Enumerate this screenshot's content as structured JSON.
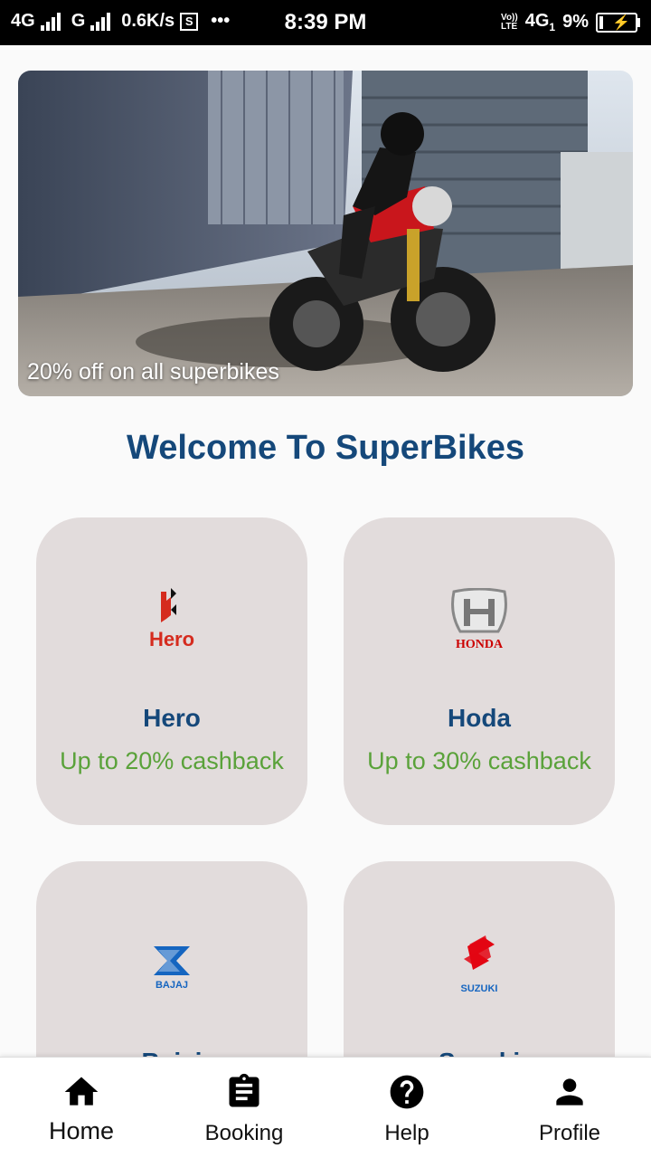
{
  "status_bar": {
    "net1": "4G",
    "net2": "G",
    "speed": "0.6K/s",
    "s_icon": "S",
    "more": "•••",
    "time": "8:39 PM",
    "volte_top": "Vo))",
    "volte_bottom": "LTE",
    "net3": "4G",
    "sim_num": "1",
    "battery": "9%"
  },
  "banner": {
    "caption": "20% off on all superbikes"
  },
  "welcome_title": "Welcome To SuperBikes",
  "brands": [
    {
      "name": "Hero",
      "offer": "Up to 20% cashback",
      "logo_text": "Hero",
      "icon": "hero-logo-icon"
    },
    {
      "name": "Hoda",
      "offer": "Up to 30% cashback",
      "logo_text": "HONDA",
      "icon": "honda-logo-icon"
    },
    {
      "name": "Bajaj",
      "offer": "",
      "logo_text": "BAJAJ",
      "icon": "bajaj-logo-icon"
    },
    {
      "name": "Suzuki",
      "offer": "",
      "logo_text": "SUZUKI",
      "icon": "suzuki-logo-icon"
    }
  ],
  "nav": [
    {
      "label": "Home",
      "icon": "home-icon"
    },
    {
      "label": "Booking",
      "icon": "clipboard-icon"
    },
    {
      "label": "Help",
      "icon": "help-icon"
    },
    {
      "label": "Profile",
      "icon": "person-icon"
    }
  ],
  "colors": {
    "title": "#15487a",
    "offer": "#5aa23a",
    "card_bg": "#e2dcdc",
    "hero_red": "#d52b1e",
    "honda_red": "#cc0000",
    "bajaj_blue": "#1565c0",
    "suzuki_red": "#e30613"
  }
}
